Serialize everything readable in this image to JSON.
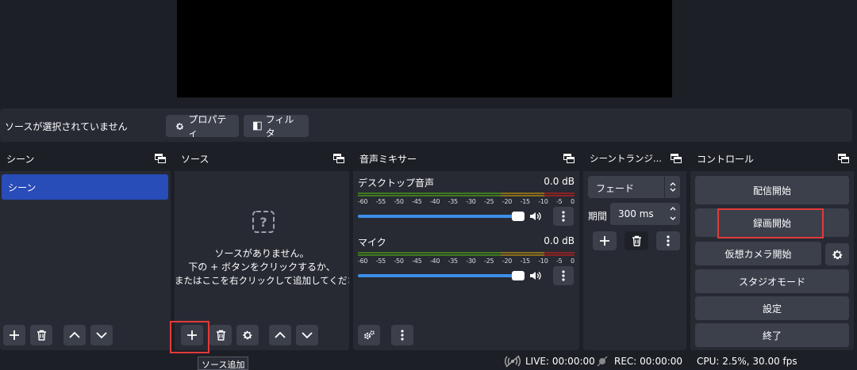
{
  "source_toolbar": {
    "status": "ソースが選択されていません",
    "properties_label": "プロパティ",
    "filters_label": "フィルタ"
  },
  "scenes": {
    "title": "シーン",
    "items": [
      "シーン"
    ]
  },
  "sources": {
    "title": "ソース",
    "empty_line1": "ソースがありません。",
    "empty_line2": "下の + ボタンをクリックするか、",
    "empty_line3": "またはここを右クリックして追加してください。",
    "tooltip": "ソース追加"
  },
  "mixer": {
    "title": "音声ミキサー",
    "ticks": [
      "-60",
      "-55",
      "-50",
      "-45",
      "-40",
      "-35",
      "-30",
      "-25",
      "-20",
      "-15",
      "-10",
      "-5",
      "0"
    ],
    "tracks": [
      {
        "name": "デスクトップ音声",
        "level": "0.0 dB",
        "volume": 1.0
      },
      {
        "name": "マイク",
        "level": "0.0 dB",
        "volume": 1.0
      }
    ]
  },
  "transitions": {
    "title": "シーントランジ...",
    "selected": "フェード",
    "duration_label": "期間",
    "duration_value": "300 ms"
  },
  "controls": {
    "title": "コントロール",
    "start_streaming": "配信開始",
    "start_recording": "録画開始",
    "start_virtual_camera": "仮想カメラ開始",
    "studio_mode": "スタジオモード",
    "settings": "設定",
    "exit": "終了"
  },
  "status_bar": {
    "live": "LIVE: 00:00:00",
    "rec": "REC: 00:00:00",
    "cpu": "CPU: 2.5%, 30.00 fps"
  },
  "colors": {
    "background": "#1d1f26",
    "panel": "#272a33",
    "button": "#3c404b",
    "selection": "#284cb8",
    "slider": "#3d8ee8",
    "highlight": "#e23a3a"
  }
}
